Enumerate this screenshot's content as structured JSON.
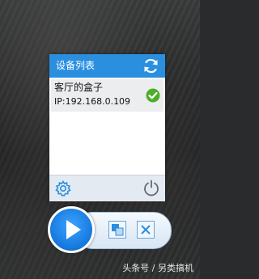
{
  "panel": {
    "title": "设备列表",
    "header_color": "#2b8fe0"
  },
  "devices": [
    {
      "name": "客厅的盒子",
      "ip": "IP:192.168.0.109",
      "status_icon": "check-icon",
      "status_color": "#4cae2b",
      "selected": true
    }
  ],
  "icons": {
    "refresh": "refresh-icon",
    "settings": "gear-icon",
    "power": "power-icon",
    "play": "play-icon",
    "window": "window-mode-icon",
    "close": "close-icon"
  },
  "watermark": "头条号 / 另类搞机"
}
